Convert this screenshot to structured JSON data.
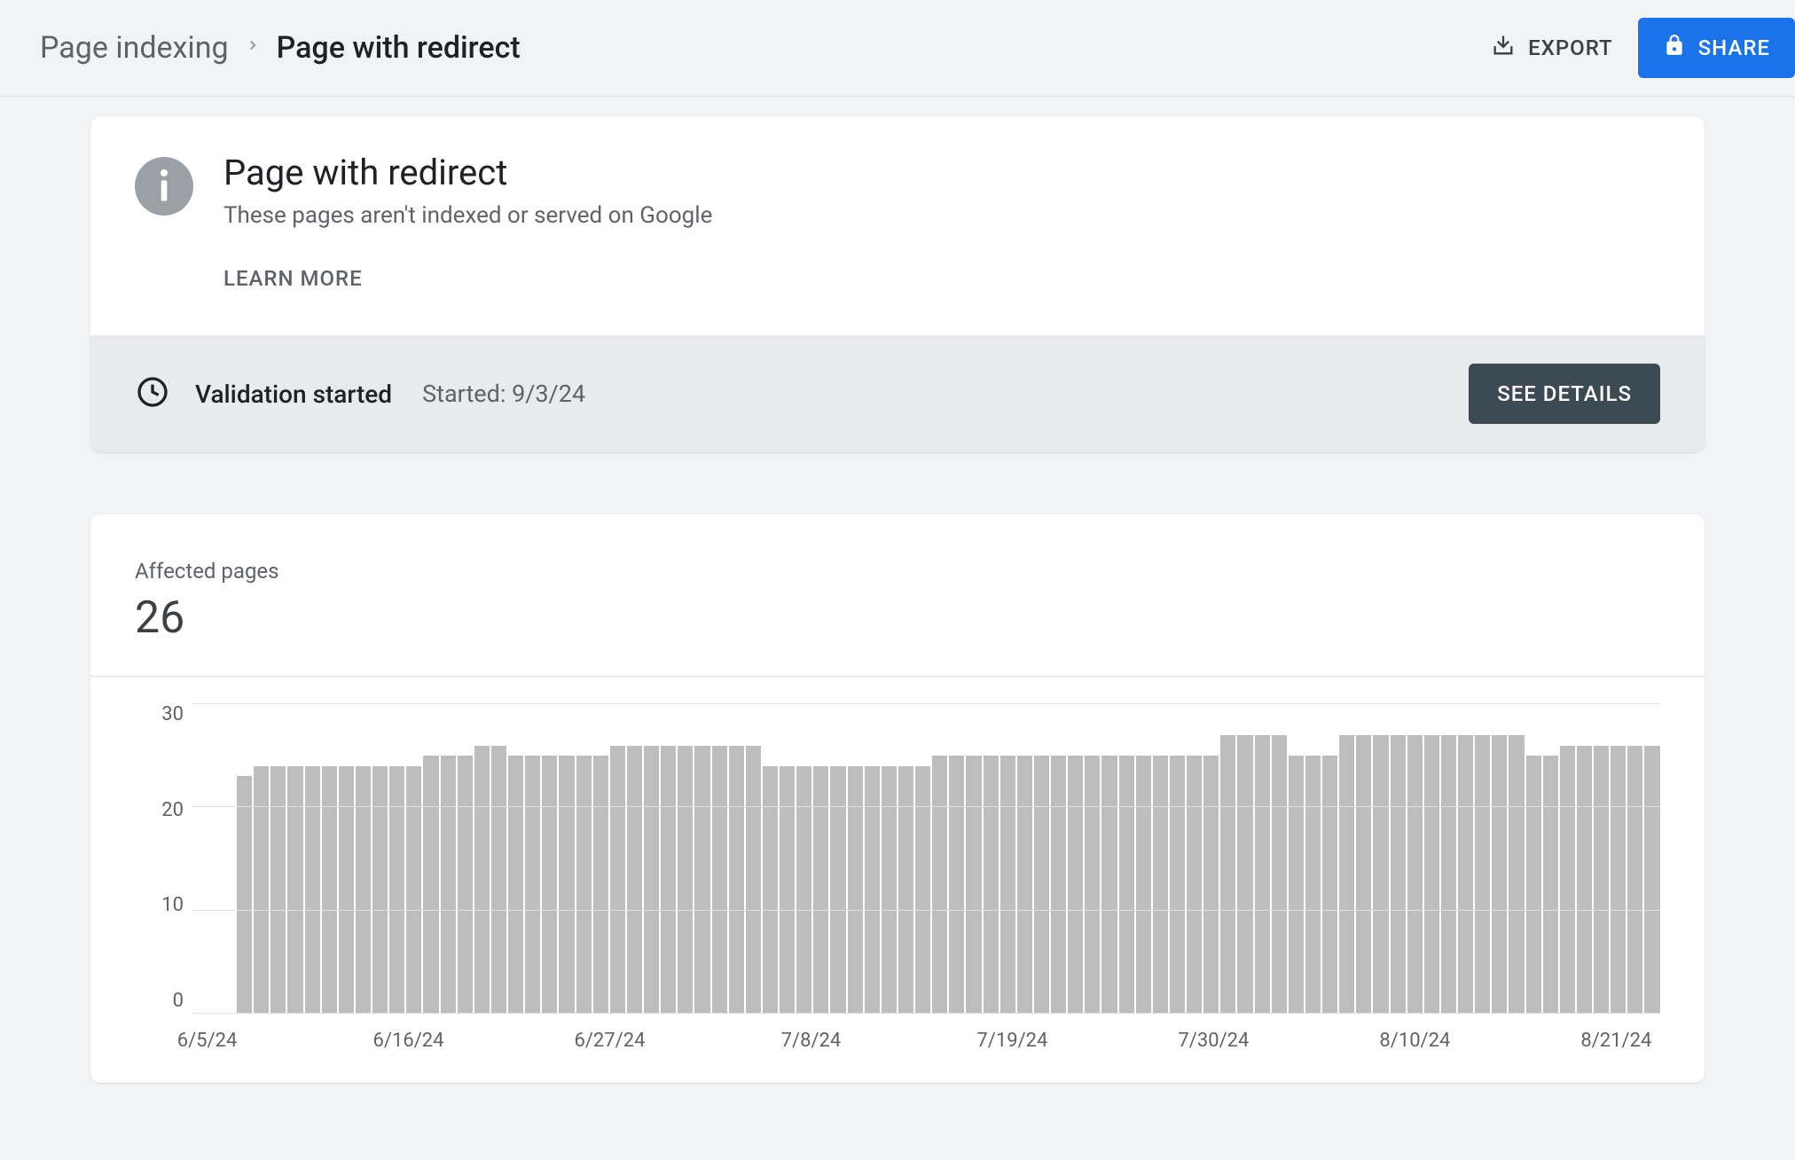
{
  "breadcrumb": {
    "parent": "Page indexing",
    "current": "Page with redirect"
  },
  "actions": {
    "export": "EXPORT",
    "share": "SHARE"
  },
  "info": {
    "title": "Page with redirect",
    "subtitle": "These pages aren't indexed or served on Google",
    "learn_more": "LEARN MORE"
  },
  "validation": {
    "title": "Validation started",
    "started_label": "Started: 9/3/24",
    "see_details": "SEE DETAILS"
  },
  "affected": {
    "label": "Affected pages",
    "count": "26"
  },
  "chart_data": {
    "type": "bar",
    "title": "Affected pages",
    "ylabel": "",
    "xlabel": "",
    "ylim": [
      0,
      30
    ],
    "y_ticks": [
      0,
      10,
      20,
      30
    ],
    "x_ticks": [
      "6/5/24",
      "6/16/24",
      "6/27/24",
      "7/8/24",
      "7/19/24",
      "7/30/24",
      "8/10/24",
      "8/21/24"
    ],
    "values": [
      23,
      24,
      24,
      24,
      24,
      24,
      24,
      24,
      24,
      24,
      24,
      25,
      25,
      25,
      26,
      26,
      25,
      25,
      25,
      25,
      25,
      25,
      26,
      26,
      26,
      26,
      26,
      26,
      26,
      26,
      26,
      24,
      24,
      24,
      24,
      24,
      24,
      24,
      24,
      24,
      24,
      25,
      25,
      25,
      25,
      25,
      25,
      25,
      25,
      25,
      25,
      25,
      25,
      25,
      25,
      25,
      25,
      25,
      27,
      27,
      27,
      27,
      25,
      25,
      25,
      27,
      27,
      27,
      27,
      27,
      27,
      27,
      27,
      27,
      27,
      27,
      25,
      25,
      26,
      26,
      26,
      26,
      26,
      26
    ]
  }
}
